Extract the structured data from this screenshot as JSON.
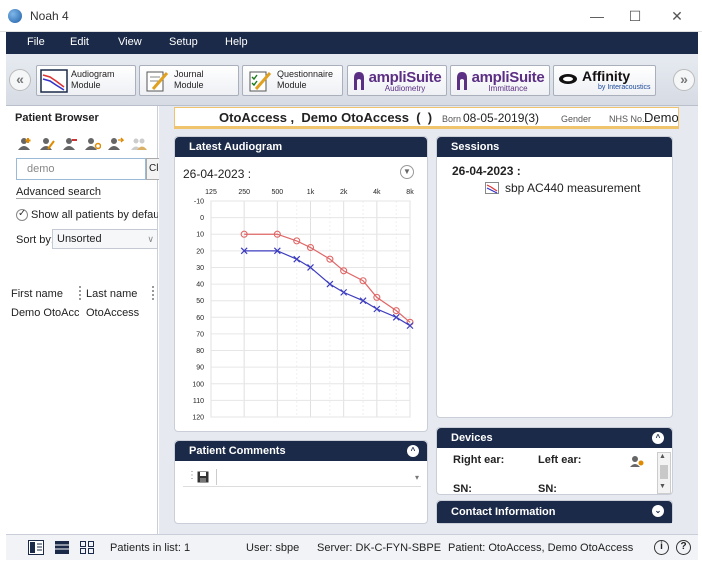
{
  "window": {
    "title": "Noah 4"
  },
  "menu": {
    "items": [
      "File",
      "Edit",
      "View",
      "Setup",
      "Help"
    ]
  },
  "modules": {
    "audiogram": {
      "line1": "Audiogram",
      "line2": "Module"
    },
    "journal": {
      "line1": "Journal",
      "line2": "Module"
    },
    "questionnaire": {
      "line1": "Questionnaire",
      "line2": "Module"
    },
    "amplisuite_audiometry": {
      "name": "ampliSuite",
      "sub": "Audiometry"
    },
    "amplisuite_immittance": {
      "name": "ampliSuite",
      "sub": "Immittance"
    },
    "affinity": {
      "name": "Affinity",
      "sub": "by Interacoustics"
    }
  },
  "browser": {
    "title": "Patient Browser",
    "search_value": "demo",
    "clear_label": "Cle",
    "advanced_search": "Advanced search",
    "show_all_label": "Show all patients by default",
    "sort_label": "Sort by:",
    "sort_value": "Unsorted",
    "columns": [
      "First name",
      "Last name"
    ],
    "rows": [
      {
        "first": "Demo OtoAcc",
        "last": "OtoAccess"
      }
    ]
  },
  "patient": {
    "name": "OtoAccess ,  Demo OtoAccess  (  )",
    "born_label": "Born",
    "born_value": "08-05-2019(3)",
    "gender_label": "Gender",
    "nhs_label": "NHS No.",
    "nhs_value": "Demo"
  },
  "audiogram": {
    "title": "Latest Audiogram",
    "date": "26-04-2023 :",
    "freq_labels": [
      "125",
      "250",
      "500",
      "1k",
      "2k",
      "4k",
      "8k"
    ],
    "db_labels": [
      "-10",
      "0",
      "10",
      "20",
      "30",
      "40",
      "50",
      "60",
      "70",
      "80",
      "90",
      "100",
      "110",
      "120"
    ],
    "colors": {
      "right": "#e06666",
      "left": "#3d3dc0"
    }
  },
  "chart_data": {
    "type": "line",
    "title": "",
    "xlabel": "",
    "ylabel": "",
    "x_scale": "log",
    "ylim": [
      -10,
      120
    ],
    "y_inverted": true,
    "grid": true,
    "x": [
      250,
      500,
      750,
      1000,
      1500,
      2000,
      3000,
      4000,
      6000,
      8000
    ],
    "series": [
      {
        "values": [
          10,
          10,
          14,
          18,
          25,
          32,
          38,
          48,
          56,
          63
        ],
        "marker": "circle",
        "color": "#e06666"
      },
      {
        "values": [
          20,
          20,
          25,
          30,
          40,
          45,
          50,
          55,
          60,
          65
        ],
        "marker": "x",
        "color": "#3d3dc0"
      }
    ]
  },
  "sessions": {
    "title": "Sessions",
    "date": "26-04-2023 :",
    "item": "sbp AC440 measurement"
  },
  "comments": {
    "title": "Patient Comments"
  },
  "devices": {
    "title": "Devices",
    "right_ear": "Right ear:",
    "left_ear": "Left ear:",
    "sn_right": "SN:",
    "sn_left": "SN:"
  },
  "contact": {
    "title": "Contact Information"
  },
  "status": {
    "patients_in_list": "Patients in list: 1",
    "user": "User: sbpe",
    "server": "Server: DK-C-FYN-SBPE",
    "patient": "Patient: OtoAccess, Demo OtoAccess"
  }
}
